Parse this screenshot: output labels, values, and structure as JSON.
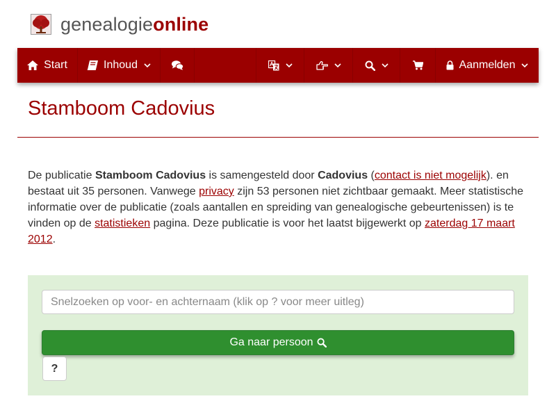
{
  "logo": {
    "part1": "genealogie",
    "part2": "online",
    "icon": "tree-logo-icon"
  },
  "nav": {
    "start_label": "Start",
    "inhoud_label": "Inhoud",
    "login_label": "Aanmelden",
    "icons": [
      "home-icon",
      "book-icon",
      "comments-icon",
      "language-icon",
      "hand-pointer-icon",
      "search-icon",
      "cart-icon",
      "lock-icon",
      "chevron-down-icon"
    ]
  },
  "page": {
    "title": "Stamboom Cadovius"
  },
  "intro": {
    "t1": "De publicatie ",
    "pub_name": "Stamboom Cadovius",
    "t2": " is samengesteld door ",
    "author": "Cadovius",
    "t3": " (",
    "contact_link": "contact is niet mogelijk",
    "t4": "). en bestaat uit 35 personen. Vanwege ",
    "privacy_link": "privacy",
    "t5": " zijn 53 personen niet zichtbaar gemaakt. Meer statistische informatie over de publicatie (zoals aantallen en spreiding van genealogische gebeurtenissen) is te vinden op de ",
    "stats_link": "statistieken",
    "t6": " pagina. Deze publicatie is voor het laatst bijgewerkt op ",
    "date_link": "zaterdag 17 maart 2012",
    "t7": "."
  },
  "search": {
    "placeholder": "Snelzoeken op voor- en achternaam (klik op ? voor meer uitleg)",
    "button_label": "Ga naar persoon",
    "help_label": "?"
  },
  "colors": {
    "brand": "#9b0000",
    "success": "#2f8f2f",
    "panel": "#dff0d8"
  }
}
